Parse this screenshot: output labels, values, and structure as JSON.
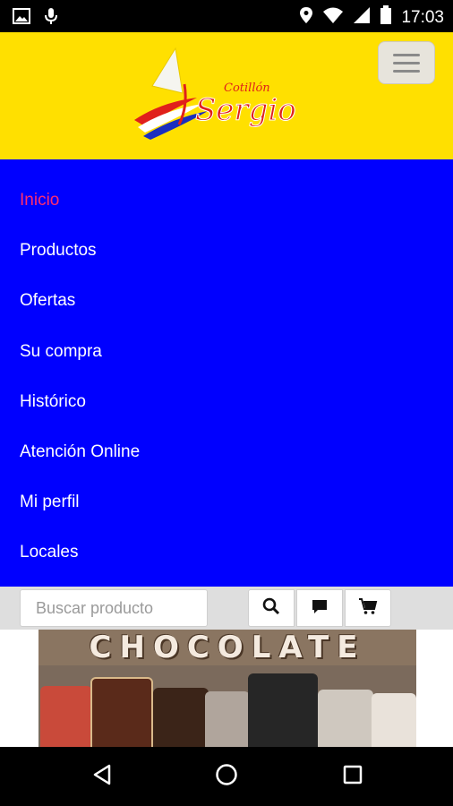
{
  "status_bar": {
    "time": "17:03",
    "icons": [
      "image-icon",
      "mic-icon",
      "location-icon",
      "wifi-icon",
      "signal-icon",
      "battery-icon"
    ]
  },
  "header": {
    "logo": {
      "line1": "Cotillón",
      "line2": "Sergio"
    },
    "menu_button_icon": "hamburger-icon",
    "background_color": "#ffe000"
  },
  "menu": {
    "background_color": "#0000ff",
    "active_color": "#ff2d6f",
    "items": [
      {
        "label": "Inicio",
        "active": true
      },
      {
        "label": "Productos"
      },
      {
        "label": "Ofertas"
      },
      {
        "label": "Su compra"
      },
      {
        "label": "Histórico"
      },
      {
        "label": "Atención Online"
      },
      {
        "label": "Mi perfil"
      },
      {
        "label": "Locales"
      }
    ]
  },
  "search": {
    "placeholder": "Buscar producto",
    "value": "",
    "buttons": [
      "search-icon",
      "chat-icon",
      "cart-icon"
    ]
  },
  "banner": {
    "title": "CHOCOLATE"
  },
  "navigation_bar": {
    "buttons": [
      "back-icon",
      "home-icon",
      "recents-icon"
    ]
  }
}
